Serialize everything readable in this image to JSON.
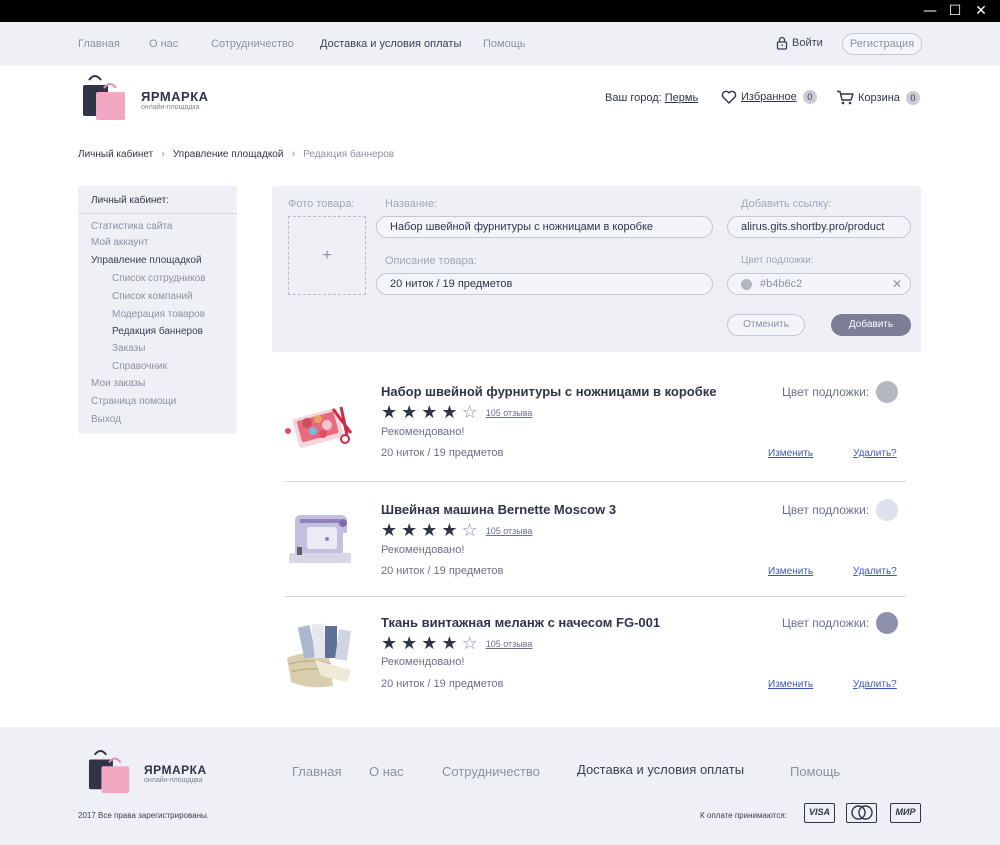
{
  "window": {
    "minimize_glyph": "—",
    "maximize_glyph": "☐",
    "close_glyph": "✕"
  },
  "topnav": {
    "links": [
      "Главная",
      "О нас",
      "Сотрудничество",
      "Доставка и условия оплаты",
      "Помощь"
    ],
    "active_index": 3,
    "login_label": "Войти",
    "register_label": "Регистрация"
  },
  "logo": {
    "name": "ЯРМАРКА",
    "tagline": "онлайн-площадка"
  },
  "header": {
    "city_prefix": "Ваш город:",
    "city": "Пермь",
    "favorites_label": "Избранное",
    "favorites_count": "0",
    "cart_label": "Корзина",
    "cart_count": "0"
  },
  "breadcrumbs": [
    "Личный кабинет",
    "Управление площадкой",
    "Редакция баннеров"
  ],
  "sidebar": {
    "heading": "Личный кабинет:",
    "items": [
      {
        "label": "Статистика сайта",
        "level": 0,
        "active": false
      },
      {
        "label": "Мой аккаунт",
        "level": 0,
        "active": false
      },
      {
        "label": "Управление площадкой",
        "level": 0,
        "active": true
      },
      {
        "label": "Список сотрудников",
        "level": 1,
        "active": false
      },
      {
        "label": "Список компаний",
        "level": 1,
        "active": false
      },
      {
        "label": "Модерация товаров",
        "level": 1,
        "active": false
      },
      {
        "label": "Редакция баннеров",
        "level": 1,
        "active": true
      },
      {
        "label": "Заказы",
        "level": 1,
        "active": false
      },
      {
        "label": "Справочник",
        "level": 1,
        "active": false
      },
      {
        "label": "Мои заказы",
        "level": 0,
        "active": false
      },
      {
        "label": "Страница помощи",
        "level": 0,
        "active": false
      },
      {
        "label": "Выход",
        "level": 0,
        "active": false
      }
    ]
  },
  "form": {
    "photo_label": "Фото товара:",
    "photo_plus": "+",
    "name_label": "Название:",
    "name_value": "Набор швейной фурнитуры с ножницами в коробке",
    "link_label": "Добавить ссылку:",
    "link_value": "alirus.gits.shortby.pro/product",
    "desc_label": "Описание товара:",
    "desc_value": "20 ниток / 19 предметов",
    "bg_label": "Цвет подложки:",
    "bg_value": "#b4b6c2",
    "clear_glyph": "✕",
    "cancel_label": "Отменить",
    "add_label": "Добавить"
  },
  "products": [
    {
      "title": "Набор швейной фурнитуры с ножницами в коробке",
      "rating": 4,
      "reviews": "105 отзыва",
      "recommended": "Рекомендовано!",
      "meta": "20 ниток / 19 предметов",
      "bg_label": "Цвет подложки:",
      "bg_color": "#b4b6c2",
      "edit_label": "Изменить",
      "delete_label": "Удалить?"
    },
    {
      "title": "Швейная машина Bernette Moscow 3",
      "rating": 4,
      "reviews": "105 отзыва",
      "recommended": "Рекомендовано!",
      "meta": "20 ниток / 19 предметов",
      "bg_label": "Цвет подложки:",
      "bg_color": "#dde3ec",
      "edit_label": "Изменить",
      "delete_label": "Удалить?"
    },
    {
      "title": "Ткань винтажная меланж с начесом FG-001",
      "rating": 4,
      "reviews": "105 отзыва",
      "recommended": "Рекомендовано!",
      "meta": "20 ниток / 19 предметов",
      "bg_label": "Цвет подложки:",
      "bg_color": "#8c90aa",
      "edit_label": "Изменить",
      "delete_label": "Удалить?"
    }
  ],
  "footer": {
    "links": [
      "Главная",
      "О нас",
      "Сотрудничество",
      "Доставка и условия оплаты",
      "Помощь"
    ],
    "active_index": 3,
    "copyright": "2017 Все права зарегистрированы.",
    "payment_label": "К оплате принимаются:",
    "payment_methods": [
      "VISA",
      "MasterCard",
      "МИР"
    ]
  },
  "colors": {
    "accent": "#7a7f97",
    "panel": "#eef0f6",
    "text": "#2f3547",
    "muted": "#8b91a4",
    "link": "#3d57b8",
    "logo_pink": "#f2a7c3",
    "logo_navy": "#2f3547"
  }
}
